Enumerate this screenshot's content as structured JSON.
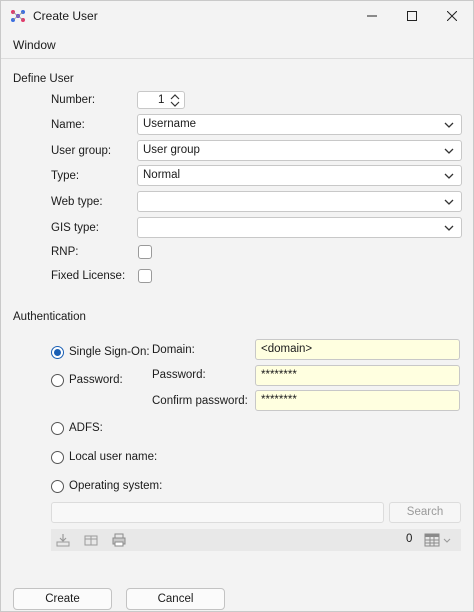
{
  "window": {
    "title": "Create User",
    "menu": [
      "Window"
    ]
  },
  "define_user": {
    "section_label": "Define User",
    "number_label": "Number:",
    "number_value": "1",
    "name_label": "Name:",
    "name_value": "Username",
    "user_group_label": "User group:",
    "user_group_value": "User group",
    "type_label": "Type:",
    "type_value": "Normal",
    "web_type_label": "Web type:",
    "web_type_value": "",
    "gis_type_label": "GIS type:",
    "gis_type_value": "",
    "rnp_label": "RNP:",
    "fixed_license_label": "Fixed License:"
  },
  "authentication": {
    "section_label": "Authentication",
    "sso_label": "Single Sign-On:",
    "password_label": "Password:",
    "adfs_label": "ADFS:",
    "local_user_label": "Local user name:",
    "os_label": "Operating system:",
    "selected": "Single Sign-On",
    "domain_label": "Domain:",
    "domain_value": "<domain>",
    "pwd_field_label": "Password:",
    "pwd_value": "********",
    "confirm_label": "Confirm password:",
    "confirm_value": "********",
    "search_button": "Search",
    "result_count": "0"
  },
  "buttons": {
    "create": "Create",
    "cancel": "Cancel"
  },
  "colors": {
    "accent": "#1a5fb4",
    "highlight_field": "#ffffe0"
  }
}
